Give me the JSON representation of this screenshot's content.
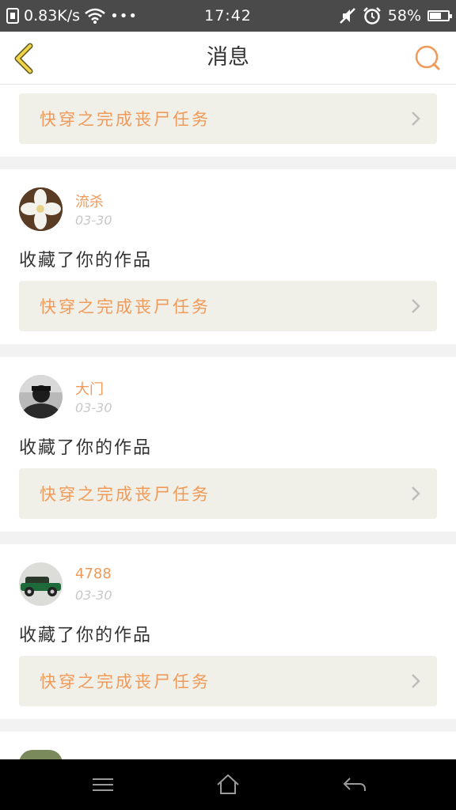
{
  "status_bar": {
    "speed": "0.83K/s",
    "time": "17:42",
    "battery": "58%",
    "battery_level": 0.58
  },
  "header": {
    "title": "消息"
  },
  "top_card": {
    "work_title": "快穿之完成丧尸任务"
  },
  "messages": [
    {
      "username": "流杀",
      "date": "03-30",
      "action": "收藏了你的作品",
      "work_title": "快穿之完成丧尸任务"
    },
    {
      "username": "大门",
      "date": "03-30",
      "action": "收藏了你的作品",
      "work_title": "快穿之完成丧尸任务"
    },
    {
      "username": "4788",
      "date": "03-30",
      "action": "收藏了你的作品",
      "work_title": "快穿之完成丧尸任务"
    }
  ],
  "colors": {
    "accent": "#f09a5a",
    "status_bar": "#4a4a4a",
    "link_bg": "#f1f0e8"
  },
  "icons": [
    "back-arrow-icon",
    "search-icon",
    "chevron-right-icon",
    "menu-icon",
    "home-icon",
    "back-icon",
    "wifi-icon",
    "alarm-icon",
    "mute-icon"
  ]
}
